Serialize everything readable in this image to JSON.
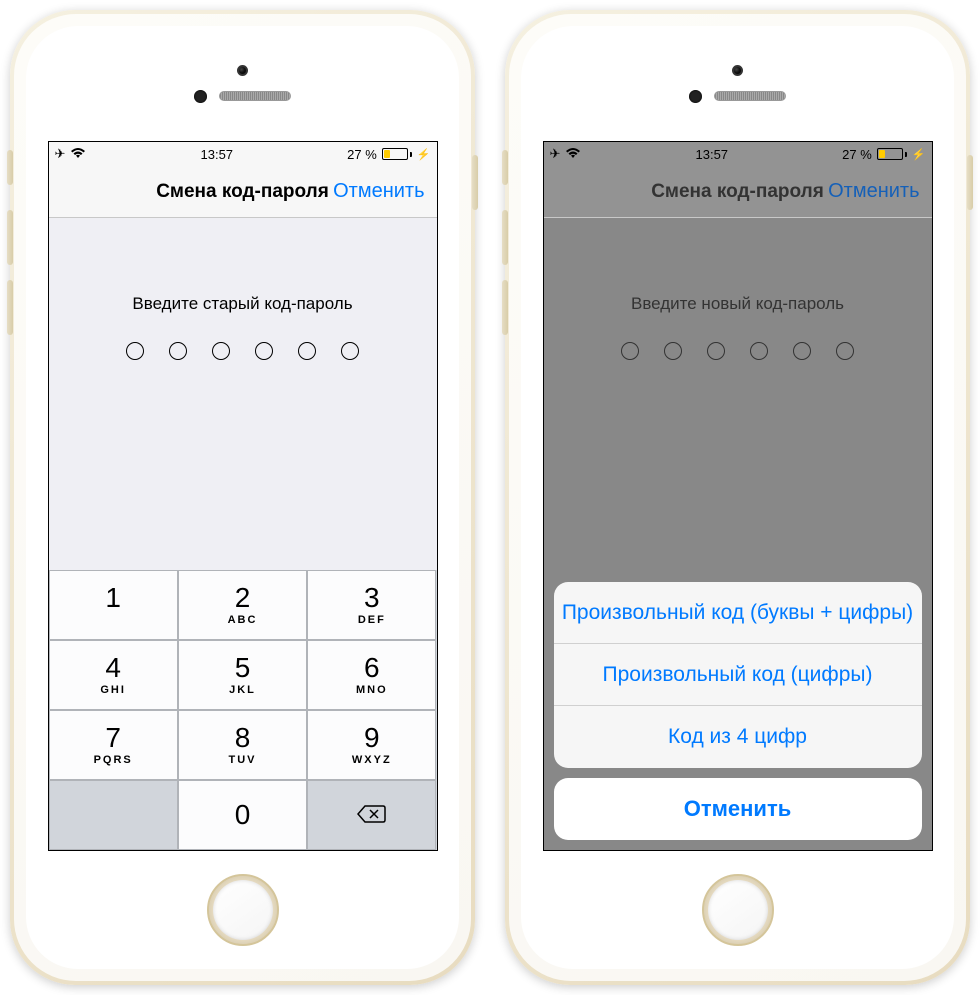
{
  "status": {
    "time": "13:57",
    "battery_pct": "27 %",
    "battery_fill_pct": 27
  },
  "nav": {
    "title": "Смена код-пароля",
    "cancel": "Отменить"
  },
  "left": {
    "prompt": "Введите старый код-пароль"
  },
  "right": {
    "prompt": "Введите новый код-пароль"
  },
  "keypad": {
    "k1": "1",
    "k2": "2",
    "k3": "3",
    "k4": "4",
    "k5": "5",
    "k6": "6",
    "k7": "7",
    "k8": "8",
    "k9": "9",
    "k0": "0",
    "l2": "ABC",
    "l3": "DEF",
    "l4": "GHI",
    "l5": "JKL",
    "l6": "MNO",
    "l7": "PQRS",
    "l8": "TUV",
    "l9": "WXYZ"
  },
  "sheet": {
    "opt1": "Произвольный код (буквы + цифры)",
    "opt2": "Произвольный код (цифры)",
    "opt3": "Код из 4 цифр",
    "cancel": "Отменить"
  }
}
